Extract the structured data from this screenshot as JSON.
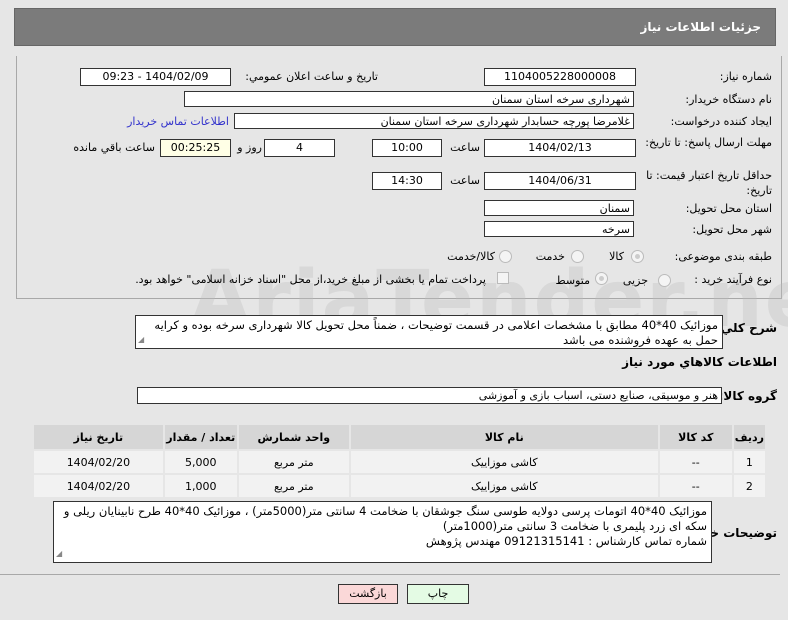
{
  "header": {
    "title": "جزئیات اطلاعات نیاز"
  },
  "form": {
    "need_number_label": "شماره نیاز:",
    "need_number": "1104005228000008",
    "announce_label": "تاریخ و ساعت اعلان عمومي:",
    "announce_value": "1404/02/09 - 09:23",
    "buyer_label": "نام دستگاه خریدار:",
    "buyer": "شهرداری سرخه استان سمنان",
    "creator_label": "ایجاد کننده درخواست:",
    "creator": "غلامرضا پورچه حسابدار شهرداری سرخه استان سمنان",
    "contact_link": "اطلاعات تماس خریدار",
    "deadline_label": "مهلت ارسال پاسخ: تا تاریخ:",
    "deadline_date": "1404/02/13",
    "time_label": "ساعت",
    "deadline_time": "10:00",
    "days": "4",
    "days_label": "روز و",
    "remaining": "00:25:25",
    "remaining_label": "ساعت باقي مانده",
    "validity_label": "حداقل تاریخ اعتبار قیمت: تا تاریخ:",
    "validity_date": "1404/06/31",
    "validity_time": "14:30",
    "province_label": "استان محل تحویل:",
    "province": "سمنان",
    "city_label": "شهر محل تحویل:",
    "city": "سرخه",
    "category_label": "طبقه بندی موضوعی:",
    "category_options": [
      "کالا",
      "خدمت",
      "کالا/خدمت"
    ],
    "process_label": "نوع فرآیند خرید :",
    "process_options": [
      "جزیی",
      "متوسط"
    ],
    "payment_note": "پرداخت تمام یا بخشی از مبلغ خرید،از محل \"اسناد خزانه اسلامی\" خواهد بود."
  },
  "summary": {
    "label": "شرح کلي نیاز:",
    "text": "موزائیک 40*40 مطابق با مشخصات اعلامی در قسمت توضیحات ، ضمناً محل تحویل کالا شهرداری سرخه بوده و کرایه حمل به عهده فروشنده می باشد"
  },
  "goods": {
    "title": "اطلاعات کالاهاي مورد نياز",
    "group_label": "گروه کالا:",
    "group": "هنر و موسیقی، صنایع دستی، اسباب بازی و آموزشی",
    "columns": [
      "ردیف",
      "کد کالا",
      "نام کالا",
      "واحد شمارش",
      "تعداد / مقدار",
      "تاریخ نیاز"
    ],
    "rows": [
      [
        "1",
        "--",
        "کاشی موزاییک",
        "متر مربع",
        "5,000",
        "1404/02/20"
      ],
      [
        "2",
        "--",
        "کاشی موزاییک",
        "متر مربع",
        "1,000",
        "1404/02/20"
      ]
    ]
  },
  "buyer_notes": {
    "label": "توضیحات خریدار:",
    "lines": [
      "موزائیک 40*40 اتومات پرسی دولایه طوسی سنگ جوشقان با ضخامت 4 سانتی متر(5000متر) ، موزائیک 40*40 طرح نابینایان ریلی و سکه ای زرد پلیمری با ضخامت 3 سانتی متر(1000متر)",
      "شماره تماس کارشناس : 09121315141 مهندس پژوهش"
    ]
  },
  "buttons": {
    "print": "چاپ",
    "back": "بازگشت"
  },
  "watermark": "AriaTender.net"
}
